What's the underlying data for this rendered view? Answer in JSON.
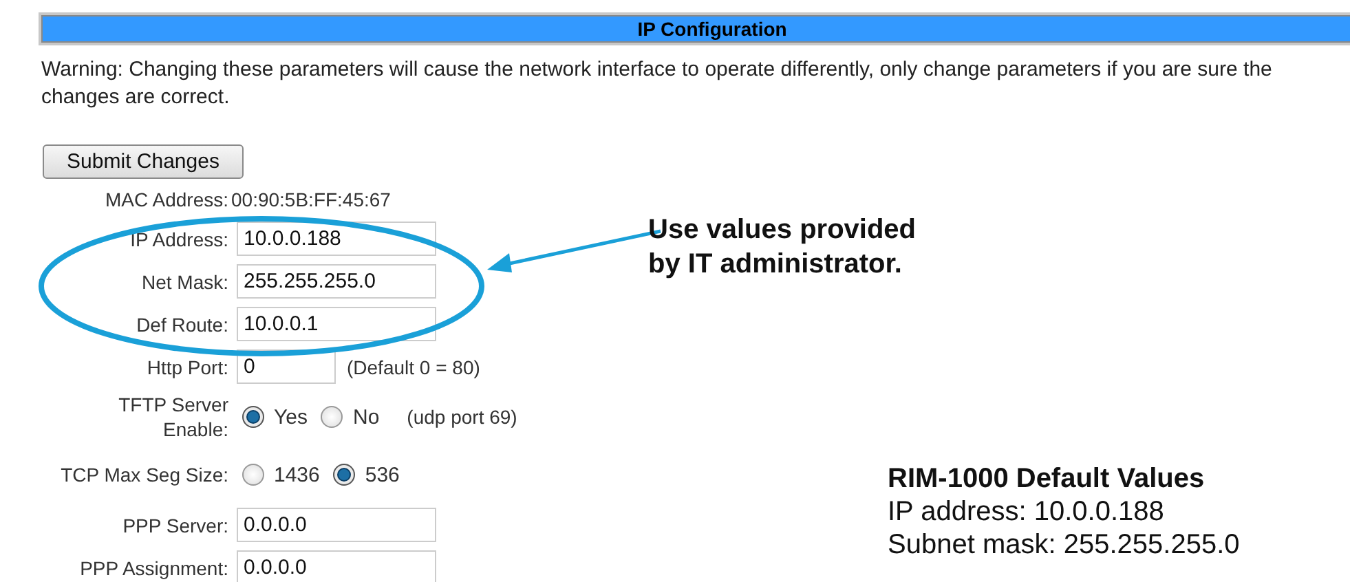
{
  "panel": {
    "title": "IP Configuration"
  },
  "warning": "Warning: Changing these parameters will cause the network interface to operate differently, only change parameters if you are sure the changes are correct.",
  "submit_button": "Submit Changes",
  "fields": [
    {
      "kind": "text",
      "label": "MAC Address:",
      "value": "00:90:5B:FF:45:67"
    },
    {
      "kind": "input",
      "label": "IP Address:",
      "value": "10.0.0.188"
    },
    {
      "kind": "input",
      "label": "Net Mask:",
      "value": "255.255.255.0"
    },
    {
      "kind": "input",
      "label": "Def Route:",
      "value": "10.0.0.1"
    },
    {
      "kind": "short_input",
      "label": "Http Port:",
      "value": "0",
      "note": "(Default 0 = 80)"
    },
    {
      "kind": "radio",
      "label": "TFTP Server\nEnable:",
      "options": [
        {
          "label": "Yes",
          "selected": true
        },
        {
          "label": "No",
          "selected": false
        }
      ],
      "note": "(udp port 69)"
    },
    {
      "kind": "radio",
      "label": "TCP Max Seg Size:",
      "options": [
        {
          "label": "1436",
          "selected": false
        },
        {
          "label": "536",
          "selected": true
        }
      ]
    },
    {
      "kind": "input",
      "label": "PPP Server:",
      "value": "0.0.0.0"
    },
    {
      "kind": "input",
      "label": "PPP Assignment:",
      "value": "0.0.0.0"
    }
  ],
  "callout": "Use values provided\nby IT administrator.",
  "defaults": {
    "title": "RIM-1000 Default Values",
    "lines": [
      "IP address: 10.0.0.188",
      "Subnet mask: 255.255.255.0"
    ]
  }
}
